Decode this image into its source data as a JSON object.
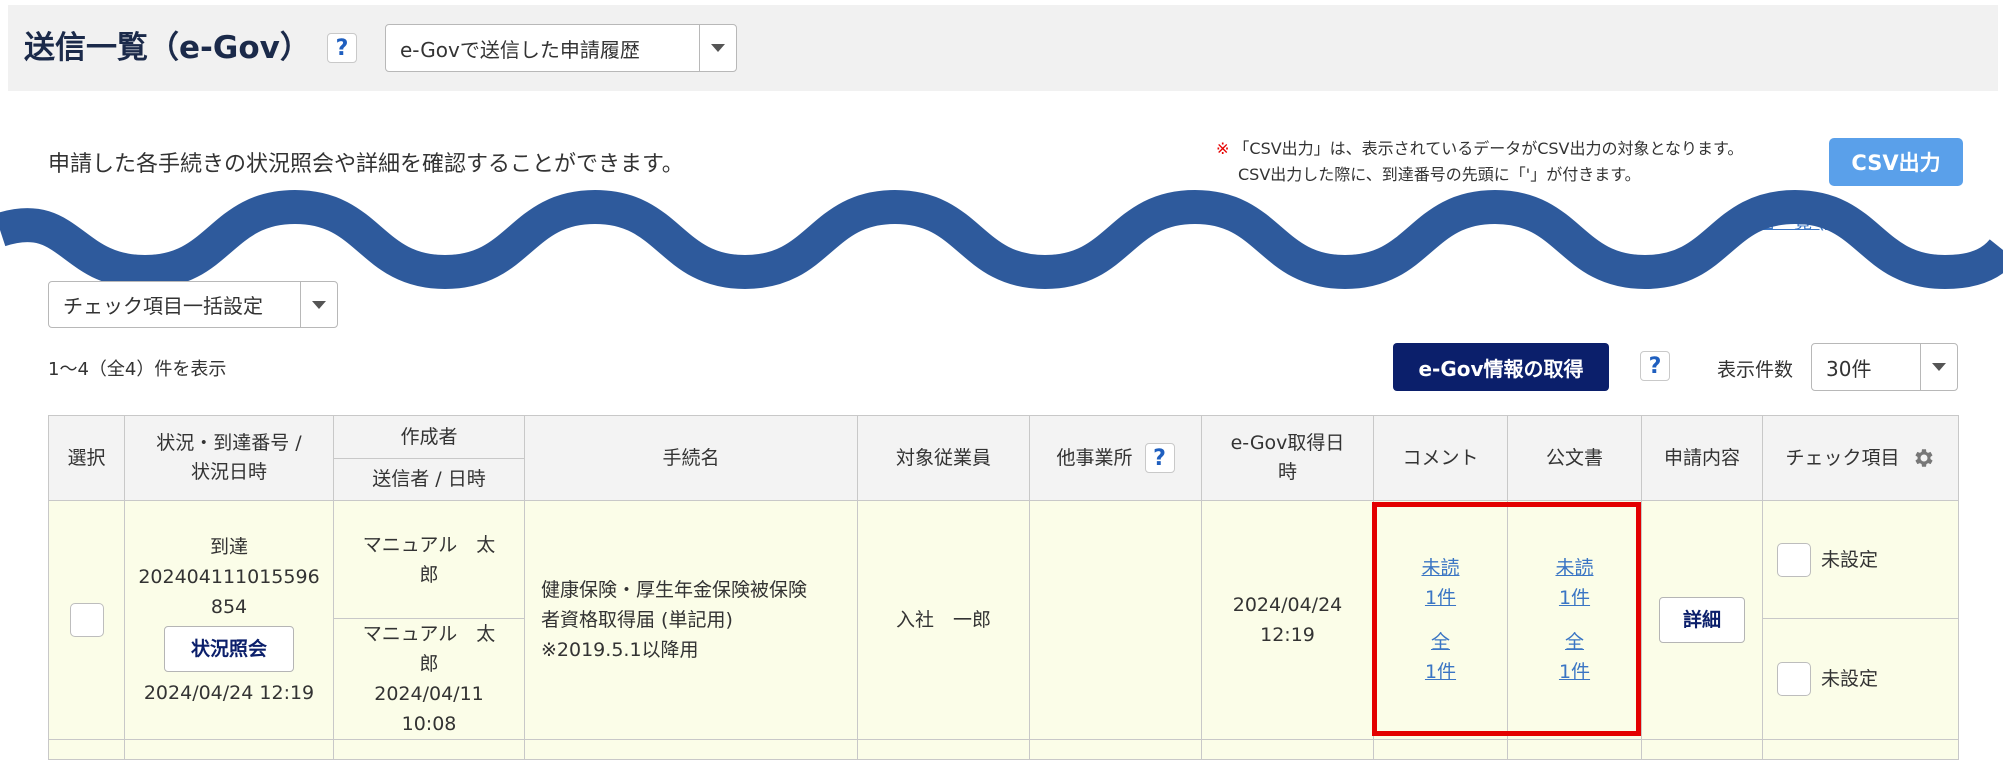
{
  "header": {
    "title": "送信一覧（e-Gov）",
    "help_label": "?",
    "history_select": "e-Govで送信した申請履歴"
  },
  "description": "申請した各手続きの状況照会や詳細を確認することができます。",
  "csv_note": {
    "mark": "※",
    "line1": "「CSV出力」は、表示されているデータがCSV出力の対象となります。",
    "line2": "CSV出力した際に、到達番号の先頭に「'」が付きます。"
  },
  "csv_button": "CSV出力",
  "public_doc_link": "公文書一覧 (従業",
  "bulk_check_select": "チェック項目一括設定",
  "count_text": "1～4（全4）件を表示",
  "egov_fetch_button": "e-Gov情報の取得",
  "display_count": {
    "label": "表示件数",
    "value": "30件"
  },
  "colors": {
    "title": "#1b2a4a",
    "accent": "#5aa0ea",
    "navy_button": "#0b1f6b",
    "row_bg": "#fbfde8",
    "highlight": "#e30000",
    "wave": "#2e5a9c"
  },
  "table": {
    "headers": {
      "select": "選択",
      "status_line1": "状況・到達番号 /",
      "status_line2": "状況日時",
      "creator": "作成者",
      "sender": "送信者 / 日時",
      "procedure": "手続名",
      "employee": "対象従業員",
      "other_office": "他事業所",
      "egov_date_line1": "e-Gov取得日",
      "egov_date_line2": "時",
      "comment": "コメント",
      "public_doc": "公文書",
      "application": "申請内容",
      "check_items": "チェック項目"
    },
    "row": {
      "status": "到達",
      "arrival_no_line1": "202404111015596",
      "arrival_no_line2": "854",
      "status_button": "状況照会",
      "status_datetime": "2024/04/24 12:19",
      "creator_line1": "マニュアル　太",
      "creator_line2": "郎",
      "sender_line1": "マニュアル　太",
      "sender_line2": "郎",
      "sender_date": "2024/04/11",
      "sender_time": "10:08",
      "procedure_line1": "健康保険・厚生年金保険被保険",
      "procedure_line2": "者資格取得届 (単記用)",
      "procedure_line3": "※2019.5.1以降用",
      "employee": "入社　一郎",
      "other_office": "",
      "egov_date": "2024/04/24",
      "egov_time": "12:19",
      "comment_unread_1": "未読",
      "comment_unread_2": "1件",
      "comment_all_1": "全",
      "comment_all_2": "1件",
      "doc_unread_1": "未読",
      "doc_unread_2": "1件",
      "doc_all_1": "全",
      "doc_all_2": "1件",
      "detail_button": "詳細",
      "check1": "未設定",
      "check2": "未設定"
    }
  }
}
